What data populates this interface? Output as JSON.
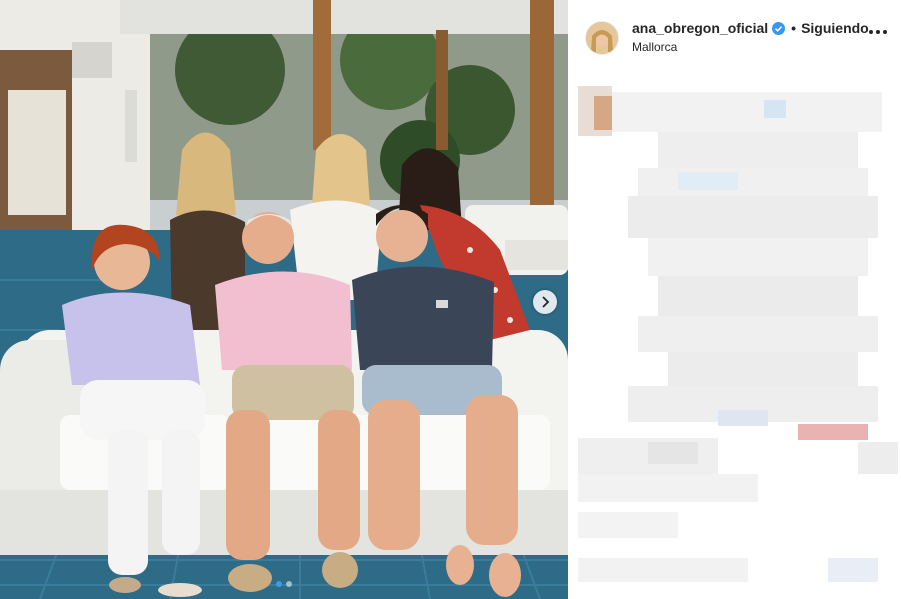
{
  "post": {
    "username": "ana_obregon_oficial",
    "separator": "•",
    "follow_state": "Siguiendo",
    "location": "Mallorca",
    "verified": true
  },
  "carousel": {
    "slide_count": 2,
    "active_index": 0,
    "next_icon": "chevron-right-icon"
  },
  "colors": {
    "accent_blue": "#3897f0",
    "text": "#262626",
    "pool_tile": "#2d6b86"
  }
}
